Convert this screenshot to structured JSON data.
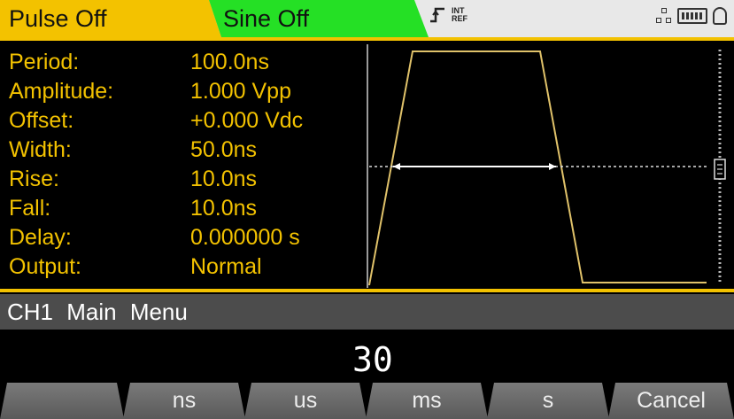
{
  "tabs": {
    "pulse": "Pulse Off",
    "sine": "Sine Off"
  },
  "reference": {
    "icon": "trigger-edge-icon",
    "text_top": "INT",
    "text_bottom": "REF"
  },
  "status_icons": [
    "lan-icon",
    "battery-icon",
    "lock-icon"
  ],
  "parameters": [
    {
      "label": "Period:",
      "value": "100.0ns"
    },
    {
      "label": "Amplitude:",
      "value": "1.000 Vpp"
    },
    {
      "label": "Offset:",
      "value": "+0.000 Vdc"
    },
    {
      "label": "Width:",
      "value": "50.0ns"
    },
    {
      "label": "Rise:",
      "value": "10.0ns"
    },
    {
      "label": "Fall:",
      "value": "10.0ns"
    },
    {
      "label": "Delay:",
      "value": "0.000000 s"
    },
    {
      "label": "Output:",
      "value": "Normal"
    }
  ],
  "menu_title": "CH1 Main Menu",
  "entry_value": "30",
  "softkeys": [
    "",
    "ns",
    "us",
    "ms",
    "s",
    "Cancel"
  ],
  "colors": {
    "pulse_tab": "#f3c200",
    "sine_tab": "#25e025",
    "text_accent": "#f3c200",
    "background": "#000000"
  }
}
